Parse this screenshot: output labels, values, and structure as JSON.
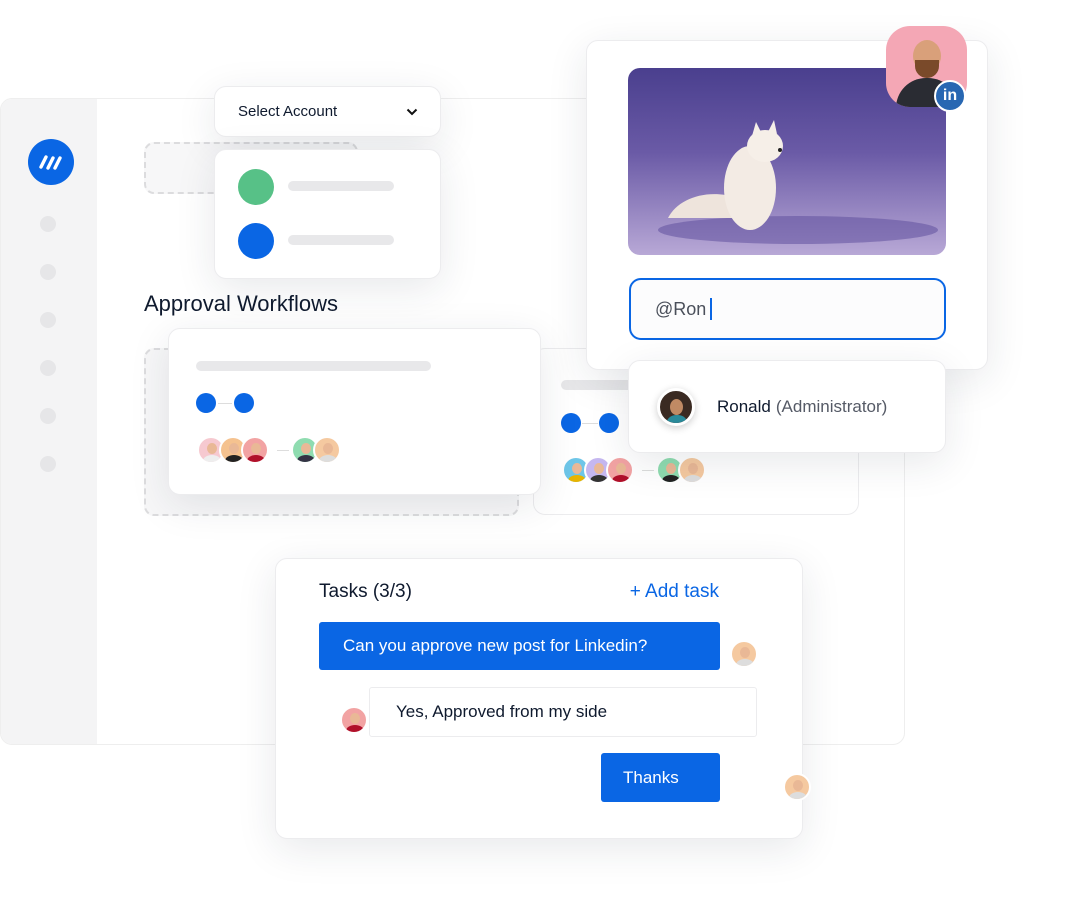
{
  "brand": {
    "accent": "#0a66e4",
    "logo_icon": "stripes-logo"
  },
  "account_select": {
    "label": "Select Account",
    "options_colors": [
      "#57c187",
      "#0a66e4"
    ]
  },
  "section_title": "Approval Workflows",
  "post_preview": {
    "image_alt": "arctic fox in snow",
    "network": "LinkedIn",
    "badge": "in"
  },
  "mention_input": {
    "value": "@Ron"
  },
  "mention_suggestion": {
    "name": "Ronald",
    "role": "(Administrator)"
  },
  "tasks": {
    "title": "Tasks (3/3)",
    "add_label": "+ Add task",
    "messages": [
      {
        "text": "Can you approve new post for Linkedin?",
        "side": "right"
      },
      {
        "text": "Yes, Approved from my side",
        "side": "left"
      },
      {
        "text": "Thanks",
        "side": "right"
      }
    ]
  }
}
